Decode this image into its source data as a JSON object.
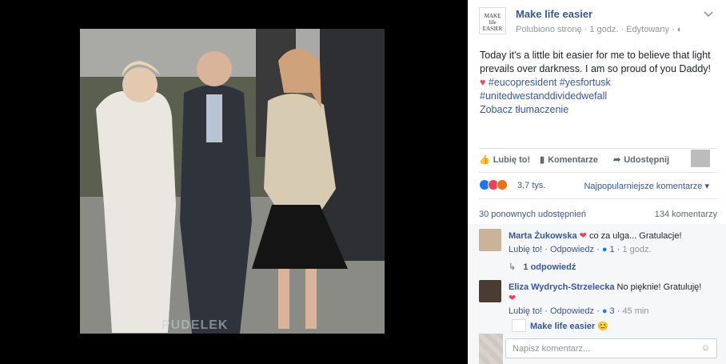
{
  "post": {
    "page_name": "Make life easier",
    "meta": "Polubiono stronę · 1 godz. · Edytowany · ",
    "text": "Today it's a little bit easier for me to believe that light prevails over darkness. I am so proud of you Daddy!",
    "hashtags_line1": "#eucopresident #yesfortusk",
    "hashtags_line2": "#unitedwestanddividedwefall",
    "see_translation": "Zobacz tłumaczenie"
  },
  "actions": {
    "like": "Lubię to!",
    "comment": "Komentarze",
    "share": "Udostępnij"
  },
  "reactions": {
    "count": "3,7 tys.",
    "sort": "Najpopularniejsze komentarze"
  },
  "stats": {
    "shares": "30 ponownych udostępnień",
    "comments": "134 komentarzy"
  },
  "comments": [
    {
      "author": "Marta Żukowska",
      "text": "co za ulga... Gratulacje!",
      "like": "Lubię to!",
      "reply": "Odpowiedz",
      "reactions": "1",
      "time": "1 godz.",
      "replies_label": "1 odpowiedź"
    },
    {
      "author": "Eliza Wydrych-Strzelecka",
      "text": "No pięknie! Gratuluję!",
      "like": "Lubię to!",
      "reply": "Odpowiedz",
      "reactions": "3",
      "time": "45 min"
    }
  ],
  "reply_preview": {
    "author": "Make life easier"
  },
  "comment_box": {
    "placeholder": "Napisz komentarz..."
  },
  "logo_text": "MAKE life EASIER",
  "watermark": "PUDELEK",
  "colors": {
    "link": "#365899",
    "like": "#1877f2",
    "love": "#f33e58",
    "angry": "#e9710f"
  }
}
